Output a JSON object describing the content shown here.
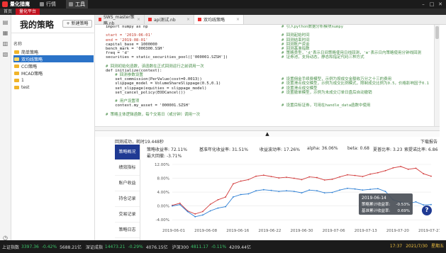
{
  "app": {
    "brand": "量化猎鹰",
    "nav": [
      {
        "label": "行情",
        "active": false
      },
      {
        "label": "工具",
        "active": true
      }
    ],
    "sub_tabs": [
      {
        "label": "首页",
        "active": false
      },
      {
        "label": "量化平台",
        "active": true
      }
    ]
  },
  "sidebar": {
    "title": "我的策略",
    "new_button": "+ 新建策略",
    "column_header": "名称",
    "items": [
      {
        "label": "简单策略",
        "selected": false
      },
      {
        "label": "双均线策略",
        "selected": true
      },
      {
        "label": "CCI策略",
        "selected": false
      },
      {
        "label": "MCAD策略",
        "selected": false
      },
      {
        "label": "1",
        "selected": false
      },
      {
        "label": "test",
        "selected": false
      }
    ]
  },
  "editor": {
    "tabs": [
      {
        "label": "SWS_master策略.nb",
        "active": false
      },
      {
        "label": "api测试.nb",
        "active": false
      },
      {
        "label": "双均线策略",
        "active": true
      }
    ],
    "lines": [
      {
        "code": "import numpy as np",
        "comment": "# 引入python数据分析模块numpy",
        "style": ""
      },
      {
        "code": "",
        "comment": "",
        "style": ""
      },
      {
        "code": "start = '2019-06-01'",
        "comment": "# 回测起始时间",
        "style": "red"
      },
      {
        "code": "end = '2019-08-01'",
        "comment": "# 回测结束时间",
        "style": "red"
      },
      {
        "code": "capital_base = 1000000",
        "comment": "# 回测账户资金",
        "style": ""
      },
      {
        "code": "bench_mark = '000300.SSH'",
        "comment": "# 回测基准指数",
        "style": ""
      },
      {
        "code": "freq = 'd'",
        "comment": "# 策略类型，'d'表示日间策略使用日线回测，'m'表示日内策略使用分钟线回测",
        "style": ""
      },
      {
        "code": "securities = static_securities_pool(['000001.SZSH'])",
        "comment": "# 证券池，支持动态，静态和指定代码三种方式",
        "style": ""
      },
      {
        "code": "",
        "comment": "",
        "style": ""
      },
      {
        "code": "# 回测初始化函数，该函数在正式回测运行之前调用一次",
        "comment": "",
        "style": "green"
      },
      {
        "code": "def initialize(context):",
        "comment": "",
        "style": ""
      },
      {
        "code": "    # 回测参数设置",
        "comment": "",
        "style": "green"
      },
      {
        "code": "    set_commission(PerValue(cost=0.0013))",
        "comment": "# 设置佣金手续费模型，示例为按成交金额收万分之十三的费用",
        "style": ""
      },
      {
        "code": "    slippage_model = VolumeShareSlippage(0.5,0.1)",
        "comment": "# 设置滑点成交模型，示例为成交比例模式，限制成交比例为0.5，价格影响因子0.1",
        "style": ""
      },
      {
        "code": "    set_slippage(equities = slippage_model)",
        "comment": "# 设置滑点成交模型",
        "style": ""
      },
      {
        "code": "    set_cancel_policy(EODCancel())",
        "comment": "# 设置撤单模型，示例为未成交订单日盘后自动撤销",
        "style": ""
      },
      {
        "code": "",
        "comment": "",
        "style": ""
      },
      {
        "code": "    # 用户设置项",
        "comment": "",
        "style": "green"
      },
      {
        "code": "    context.my_asset = '000001.SZSH'",
        "comment": "# 设置目标证券，可用在handle_data函数中使用",
        "style": ""
      },
      {
        "code": "",
        "comment": "",
        "style": ""
      },
      {
        "code": "# 策略主体逻辑函数，每个交易日（或分钟）调用一次",
        "comment": "",
        "style": "green"
      }
    ]
  },
  "splitter_icon": "▲",
  "backtest": {
    "status": "回测成功，耗时19.448秒",
    "download": "下载报告",
    "nav": [
      {
        "label": "策略概况",
        "active": true
      },
      {
        "label": "绩效指标",
        "active": false
      },
      {
        "label": "账户收益",
        "active": false
      },
      {
        "label": "持仓记录",
        "active": false
      },
      {
        "label": "交易记录",
        "active": false
      },
      {
        "label": "策略日志",
        "active": false
      }
    ],
    "metrics_row1": [
      {
        "label": "策略收益率:",
        "value": "72.11%"
      },
      {
        "label": "基准年化收益率:",
        "value": "31.51%"
      },
      {
        "label": "收益波动率:",
        "value": "17.26%"
      },
      {
        "label": "alpha:",
        "value": "36.06%"
      },
      {
        "label": "beta:",
        "value": "0.68"
      },
      {
        "label": "夏普比率:",
        "value": "3.23"
      },
      {
        "label": "索提诺比率:",
        "value": "6.86"
      }
    ],
    "metrics_row2_text": "最大回撤:",
    "metrics_row2_value": "-3.71%"
  },
  "chart_data": {
    "type": "line",
    "ylim": [
      -6,
      12
    ],
    "yticks": [
      "12.00%",
      "8.00%",
      "4.00%",
      "0.00%",
      "-4.00%"
    ],
    "ytick_values": [
      12,
      8,
      4,
      0,
      -4
    ],
    "xticks": [
      "2019-06-01",
      "2019-06-08",
      "2019-06-16",
      "2019-06-22",
      "2019-06-30",
      "2019-07-06",
      "2019-07-13",
      "2019-07-20",
      "2019-07-27"
    ],
    "series": [
      {
        "name": "策略累计收益率",
        "color": "#d23b3b",
        "values": [
          0.2,
          0.8,
          -1.4,
          -2.3,
          -1.6,
          0.5,
          1.8,
          2.6,
          6.4,
          7.2,
          7.6,
          8.6,
          8.9,
          8.5,
          8.1,
          8.3,
          8.0,
          7.6,
          8.4,
          8.2,
          7.5,
          7.7,
          8.4,
          9.0,
          8.8,
          8.5,
          9.2,
          9.6,
          10.2,
          11.0,
          11.4,
          10.6,
          10.9,
          9.3,
          8.6
        ]
      },
      {
        "name": "基准累计收益率",
        "color": "#2d7fd4",
        "values": [
          0.0,
          0.4,
          -1.6,
          -3.1,
          -2.6,
          -1.4,
          -0.6,
          -0.2,
          2.6,
          3.3,
          3.5,
          4.4,
          4.7,
          4.5,
          4.2,
          4.4,
          4.2,
          3.8,
          4.6,
          4.4,
          3.8,
          3.9,
          4.6,
          5.1,
          4.9,
          4.6,
          4.8,
          5.0,
          4.2,
          1.8,
          1.1,
          0.7,
          1.2,
          0.3,
          0.4
        ]
      }
    ],
    "tooltip": {
      "date": "2019-06-14",
      "strategy_label": "策略累计收益率:",
      "strategy_value": "-0.53%",
      "benchmark_label": "基准累计收益率:",
      "benchmark_value": "0.69%"
    }
  },
  "help_icon": "?",
  "ticker": [
    {
      "name": "上证指数",
      "value": "3397.36",
      "change": "-0.42%",
      "amount": "5688.21亿"
    },
    {
      "name": "深证成指",
      "value": "14473.21",
      "change": "-0.29%",
      "amount": "4076.15亿"
    },
    {
      "name": "沪深300",
      "value": "4811.17",
      "change": "-0.11%",
      "amount": "4209.44亿"
    }
  ],
  "clock": {
    "time": "17:37",
    "date": "2021/7/30",
    "weekday": "星期五"
  }
}
